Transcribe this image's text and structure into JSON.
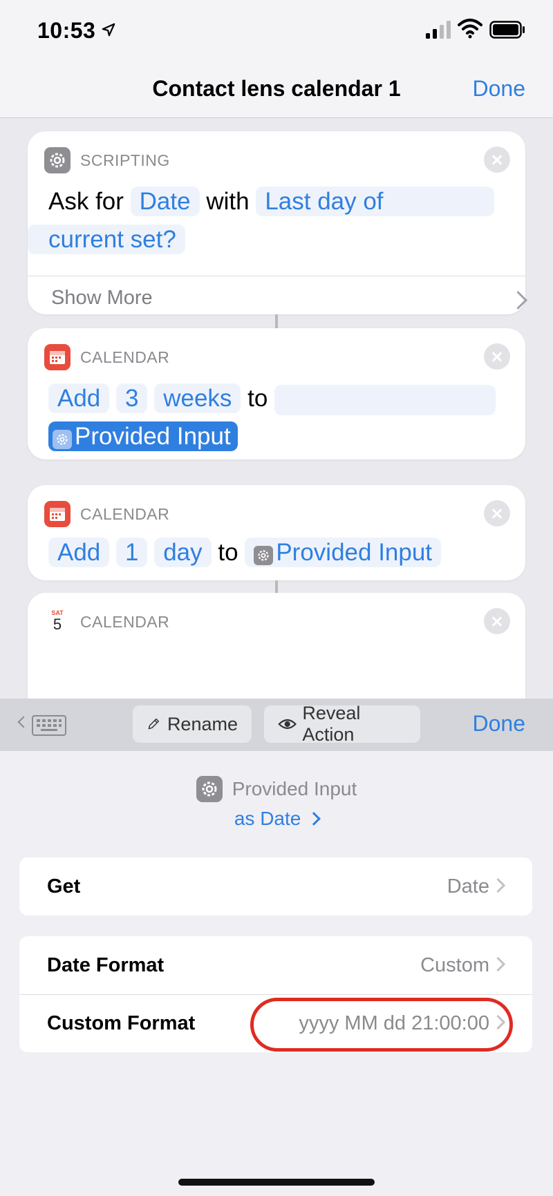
{
  "status_bar": {
    "time": "10:53"
  },
  "nav": {
    "title": "Contact lens calendar 1",
    "done_label": "Done"
  },
  "actions": [
    {
      "category": "SCRIPTING",
      "line1": {
        "verb": "Ask for",
        "type_token": "Date",
        "with": "with",
        "prompt_token_a": "Last day of"
      },
      "line2": {
        "prompt_token_b": "current set?"
      },
      "show_more": "Show More"
    },
    {
      "category": "CALENDAR",
      "line1": {
        "op_token": "Add",
        "num_token": "3",
        "unit_token": "weeks",
        "to": "to"
      },
      "line2": {
        "input_token": "Provided Input"
      }
    },
    {
      "category": "CALENDAR",
      "line1": {
        "op_token": "Add",
        "num_token": "1",
        "unit_token": "day",
        "to": "to",
        "input_token": "Provided Input"
      }
    },
    {
      "category": "CALENDAR",
      "icon_weekday": "SAT",
      "icon_day": "5"
    }
  ],
  "toolbar": {
    "rename_label": "Rename",
    "reveal_label": "Reveal Action",
    "done_label": "Done"
  },
  "panel": {
    "variable_name": "Provided Input",
    "as_type": "as Date",
    "rows": [
      {
        "label": "Get",
        "value": "Date"
      },
      {
        "label": "Date Format",
        "value": "Custom"
      },
      {
        "label": "Custom Format",
        "value": "yyyy MM dd 21:00:00"
      }
    ]
  },
  "colors": {
    "accent": "#2f7fe0",
    "calendar_red": "#e84c3d",
    "highlight_ring": "#e02b22"
  }
}
